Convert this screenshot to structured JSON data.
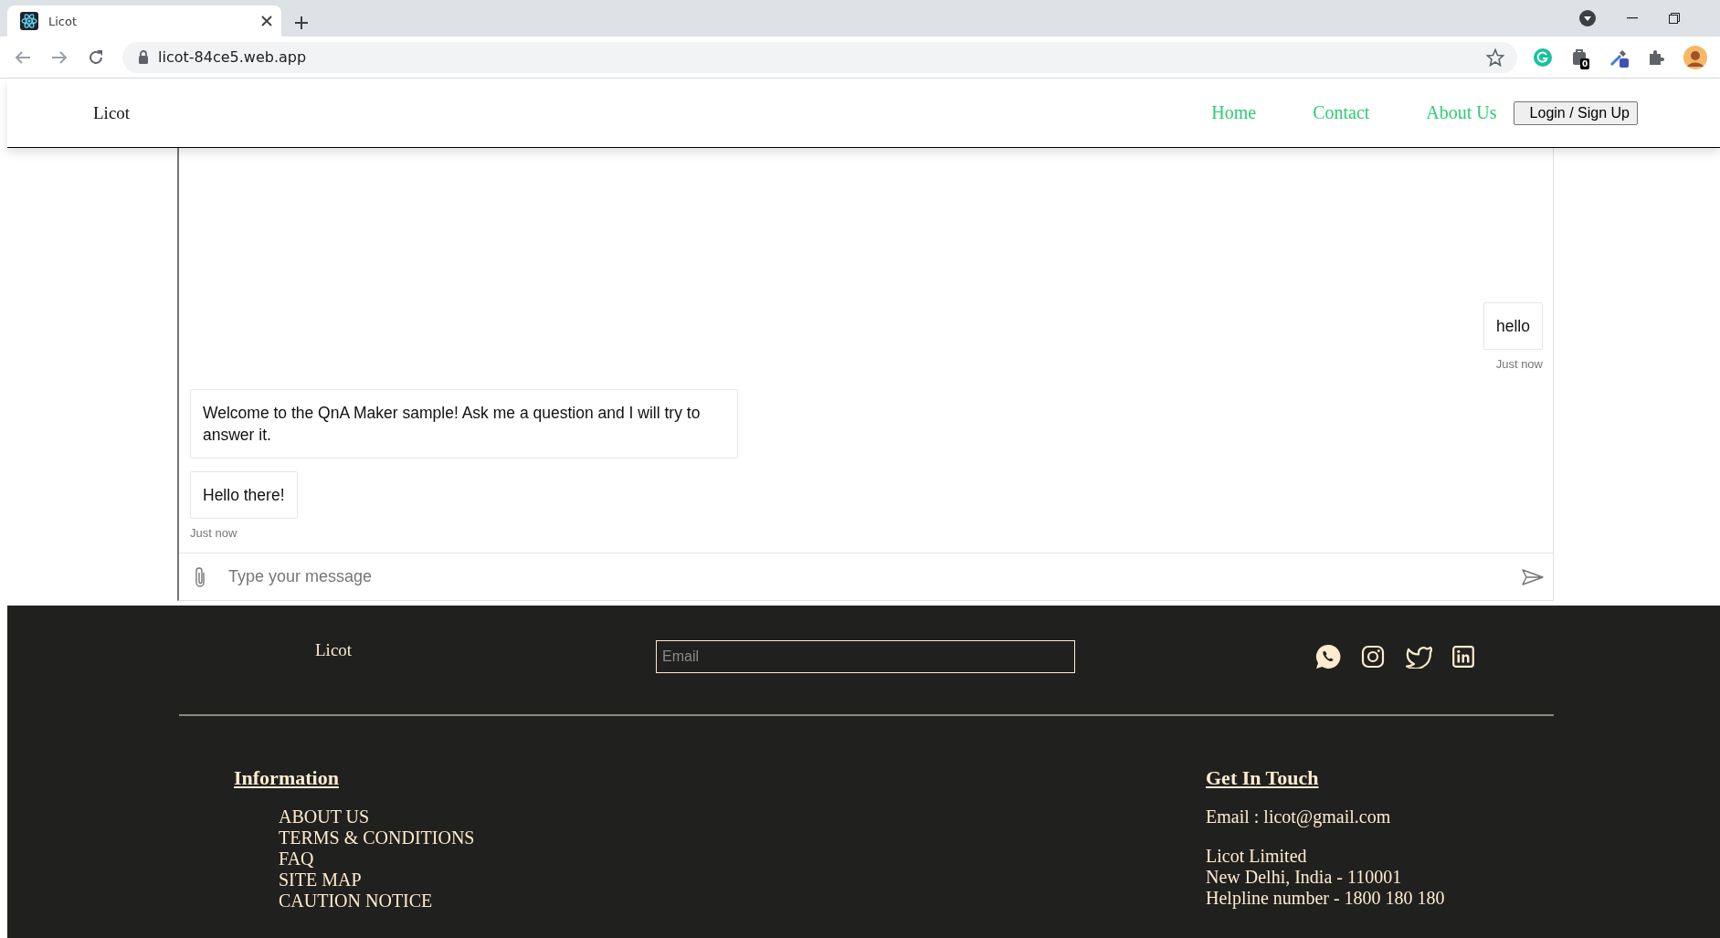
{
  "browser": {
    "tab_title": "Licot",
    "url": "licot-84ce5.web.app",
    "extension_badge": "0"
  },
  "navbar": {
    "brand": "Licot",
    "links": [
      {
        "label": "Home"
      },
      {
        "label": "Contact"
      },
      {
        "label": "About Us"
      }
    ],
    "login_button": "Login / Sign Up"
  },
  "chat": {
    "messages": [
      {
        "kind": "user",
        "text": "hello",
        "timestamp": "Just now"
      },
      {
        "kind": "bot",
        "text": "Welcome to the QnA Maker sample! Ask me a question and I will try to answer it."
      },
      {
        "kind": "bot",
        "text": "Hello there!",
        "timestamp": "Just now"
      }
    ],
    "composer": {
      "placeholder": "Type your message"
    }
  },
  "footer": {
    "brand": "Licot",
    "email_field": {
      "placeholder": "Email"
    },
    "information": {
      "heading": "Information",
      "links": [
        "ABOUT US",
        "TERMS & CONDITIONS",
        "FAQ",
        "SITE MAP",
        "CAUTION NOTICE"
      ]
    },
    "get_in_touch": {
      "heading": "Get In Touch",
      "email": "Email : licot@gmail.com",
      "address_lines": [
        "Licot Limited",
        "New Delhi, India - 110001",
        "Helpline number - 1800 180 180"
      ]
    }
  }
}
